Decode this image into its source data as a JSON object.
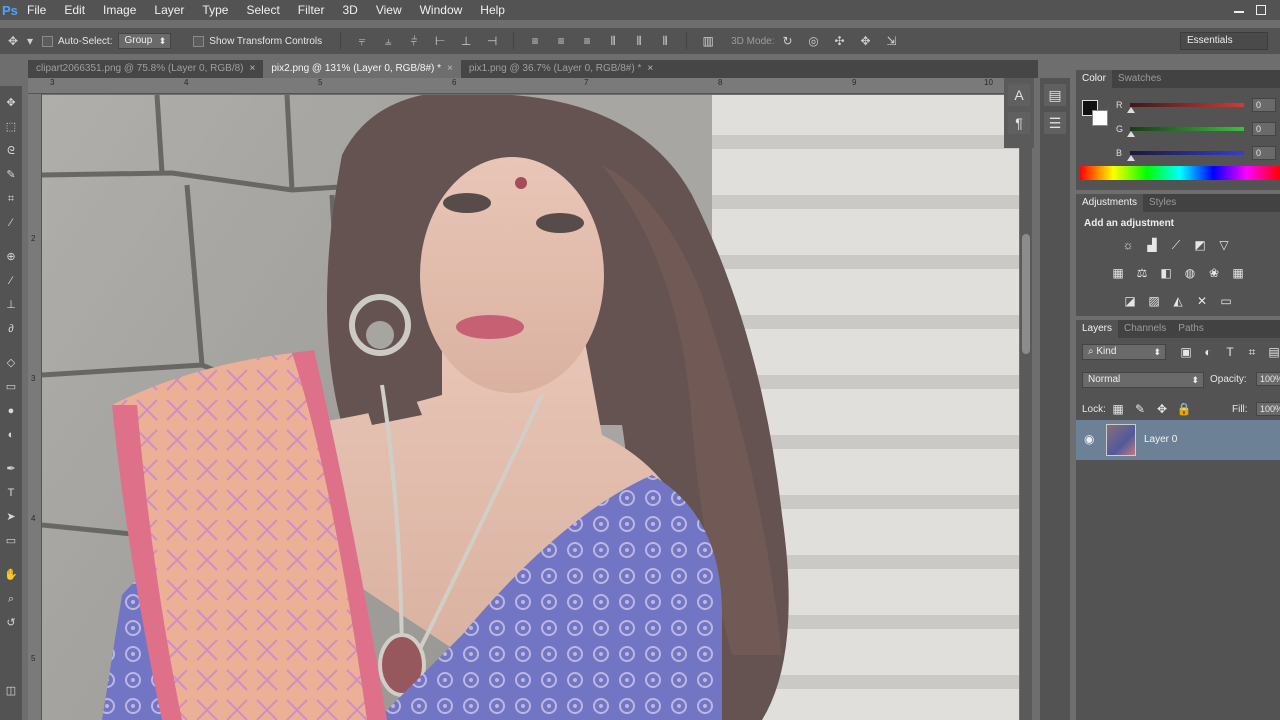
{
  "app": {
    "logo": "Ps",
    "menu": [
      "File",
      "Edit",
      "Image",
      "Layer",
      "Type",
      "Select",
      "Filter",
      "3D",
      "View",
      "Window",
      "Help"
    ]
  },
  "options": {
    "auto_select": "Auto-Select:",
    "group": "Group",
    "show_transform": "Show Transform Controls",
    "mode_3d": "3D Mode:",
    "workspace": "Essentials"
  },
  "tabs": [
    {
      "label": "clipart2066351.png @ 75.8% (Layer 0, RGB/8)",
      "close": "×"
    },
    {
      "label": "pix2.png @ 131% (Layer 0, RGB/8#) *",
      "close": "×"
    },
    {
      "label": "pix1.png @ 36.7% (Layer 0, RGB/8#) *",
      "close": "×"
    }
  ],
  "rulers": {
    "top": [
      "3",
      "4",
      "5",
      "6",
      "7",
      "8",
      "9",
      "10"
    ],
    "left": [
      "2",
      "3",
      "4",
      "5"
    ]
  },
  "color_panel": {
    "tabs": [
      "Color",
      "Swatches"
    ],
    "channels": [
      {
        "label": "R",
        "value": "0",
        "color": "#d23a3a"
      },
      {
        "label": "G",
        "value": "0",
        "color": "#3ac23a"
      },
      {
        "label": "B",
        "value": "0",
        "color": "#3a3ad2"
      }
    ]
  },
  "adjustments_panel": {
    "tabs": [
      "Adjustments",
      "Styles"
    ],
    "title": "Add an adjustment"
  },
  "layers_panel": {
    "tabs": [
      "Layers",
      "Channels",
      "Paths"
    ],
    "kind": "Kind",
    "blend_mode": "Normal",
    "opacity_label": "Opacity:",
    "opacity_value": "100%",
    "lock_label": "Lock:",
    "fill_label": "Fill:",
    "fill_value": "100%",
    "layers": [
      {
        "name": "Layer 0"
      }
    ]
  }
}
